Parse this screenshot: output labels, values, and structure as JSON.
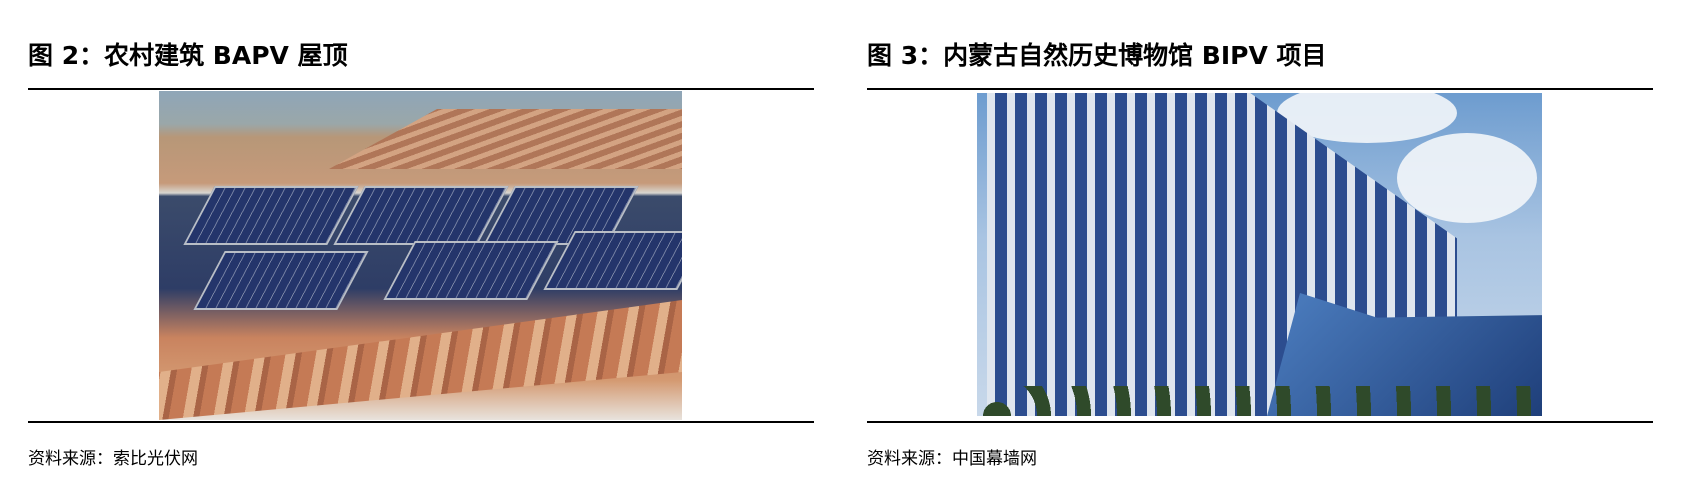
{
  "figures": [
    {
      "title": "图 2：农村建筑 BAPV 屋顶",
      "source": "资料来源：索比光伏网",
      "image": "rural-rooftop-solar-panels-photo"
    },
    {
      "title": "图 3：内蒙古自然历史博物馆 BIPV 项目",
      "source": "资料来源：中国幕墙网",
      "image": "glass-curtain-wall-building-photo"
    }
  ]
}
